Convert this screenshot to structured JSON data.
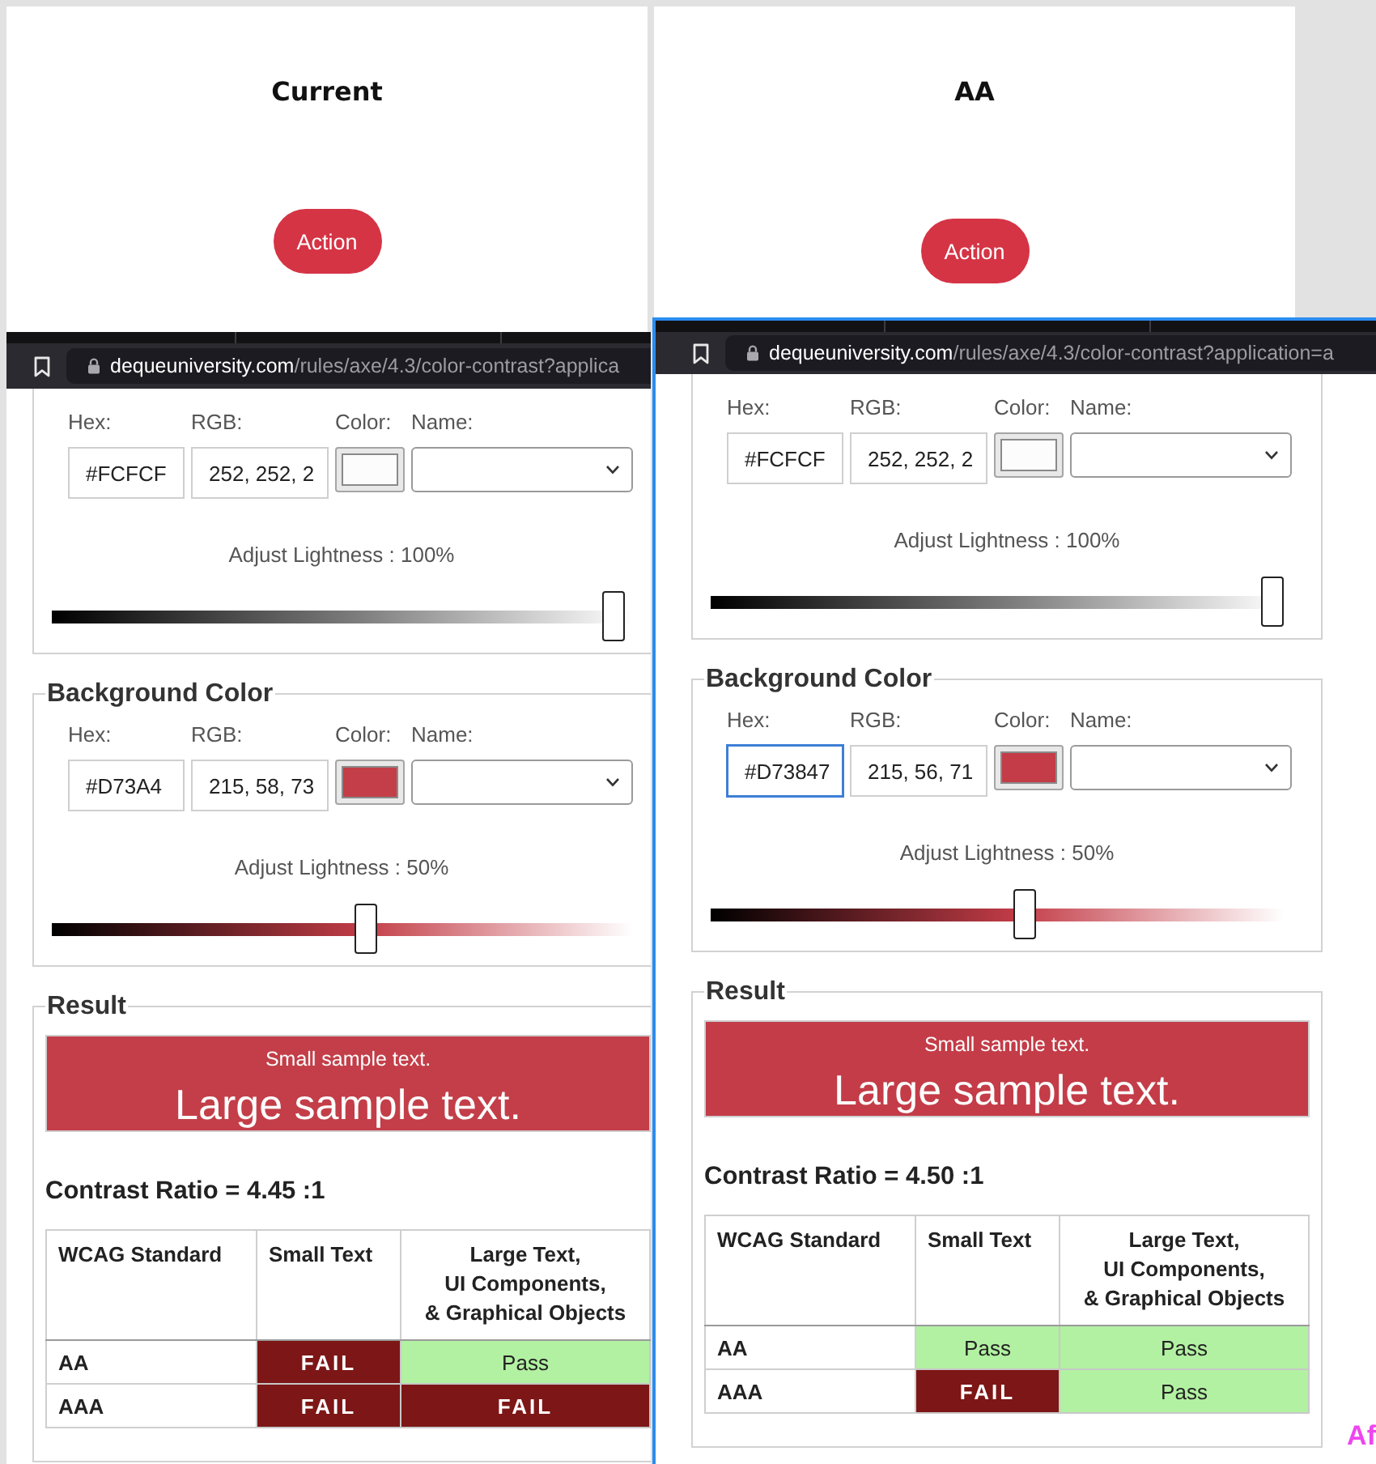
{
  "panels": [
    {
      "card": {
        "title": "Current",
        "button": "Action"
      },
      "browser": {
        "domain": "dequeuniversity.com",
        "path": "/rules/axe/4.3/color-contrast?applica"
      },
      "text_color": {
        "labels": [
          "Hex:",
          "RGB:",
          "Color:",
          "Name:"
        ],
        "hex": {
          "value": "#FCFCF",
          "focused": false
        },
        "rgb": "252, 252, 2",
        "color": "#fcfcfc",
        "lightness": "Adjust Lightness : 100%",
        "level": 1
      },
      "background_color": {
        "legend": "Background Color",
        "labels": [
          "Hex:",
          "RGB:",
          "Color:",
          "Name:"
        ],
        "hex": {
          "value": "#D73A4",
          "focused": false
        },
        "rgb": "215, 58, 73",
        "color": "#c33e48",
        "lightness": "Adjust Lightness : 50%",
        "level": 0.5
      },
      "result": {
        "legend": "Result",
        "small_sample": "Small sample text.",
        "large_sample": "Large sample text.",
        "contrast_ratio": "Contrast Ratio = 4.45 :1",
        "columns": [
          "WCAG Standard",
          "Small Text",
          "Large Text,\nUI Components,\n& Graphical Objects"
        ],
        "rows": [
          {
            "cells": [
              {
                "kind": "standard",
                "text": "AA"
              },
              {
                "kind": "fail",
                "text": "FAIL"
              },
              {
                "kind": "pass",
                "text": "Pass"
              }
            ]
          },
          {
            "cells": [
              {
                "kind": "standard",
                "text": "AAA"
              },
              {
                "kind": "fail",
                "text": "FAIL"
              },
              {
                "kind": "fail",
                "text": "FAIL"
              }
            ]
          }
        ]
      }
    },
    {
      "card": {
        "title": "AA",
        "button": "Action"
      },
      "browser": {
        "domain": "dequeuniversity.com",
        "path": "/rules/axe/4.3/color-contrast?application=a"
      },
      "text_color": {
        "labels": [
          "Hex:",
          "RGB:",
          "Color:",
          "Name:"
        ],
        "hex": {
          "value": "#FCFCF",
          "focused": false
        },
        "rgb": "252, 252, 2",
        "color": "#fcfcfc",
        "lightness": "Adjust Lightness : 100%",
        "level": 1
      },
      "background_color": {
        "legend": "Background Color",
        "labels": [
          "Hex:",
          "RGB:",
          "Color:",
          "Name:"
        ],
        "hex": {
          "value": "#D73847",
          "focused": true
        },
        "rgb": "215, 56, 71",
        "color": "#c33c47",
        "lightness": "Adjust Lightness : 50%",
        "level": 0.5
      },
      "result": {
        "legend": "Result",
        "small_sample": "Small sample text.",
        "large_sample": "Large sample text.",
        "contrast_ratio": "Contrast Ratio = 4.50 :1",
        "columns": [
          "WCAG Standard",
          "Small Text",
          "Large Text,\nUI Components,\n& Graphical Objects"
        ],
        "rows": [
          {
            "cells": [
              {
                "kind": "standard",
                "text": "AA"
              },
              {
                "kind": "pass",
                "text": "Pass"
              },
              {
                "kind": "pass",
                "text": "Pass"
              }
            ]
          },
          {
            "cells": [
              {
                "kind": "standard",
                "text": "AAA"
              },
              {
                "kind": "fail",
                "text": "FAIL"
              },
              {
                "kind": "pass",
                "text": "Pass"
              }
            ]
          }
        ]
      }
    }
  ],
  "corner_text": "Af"
}
